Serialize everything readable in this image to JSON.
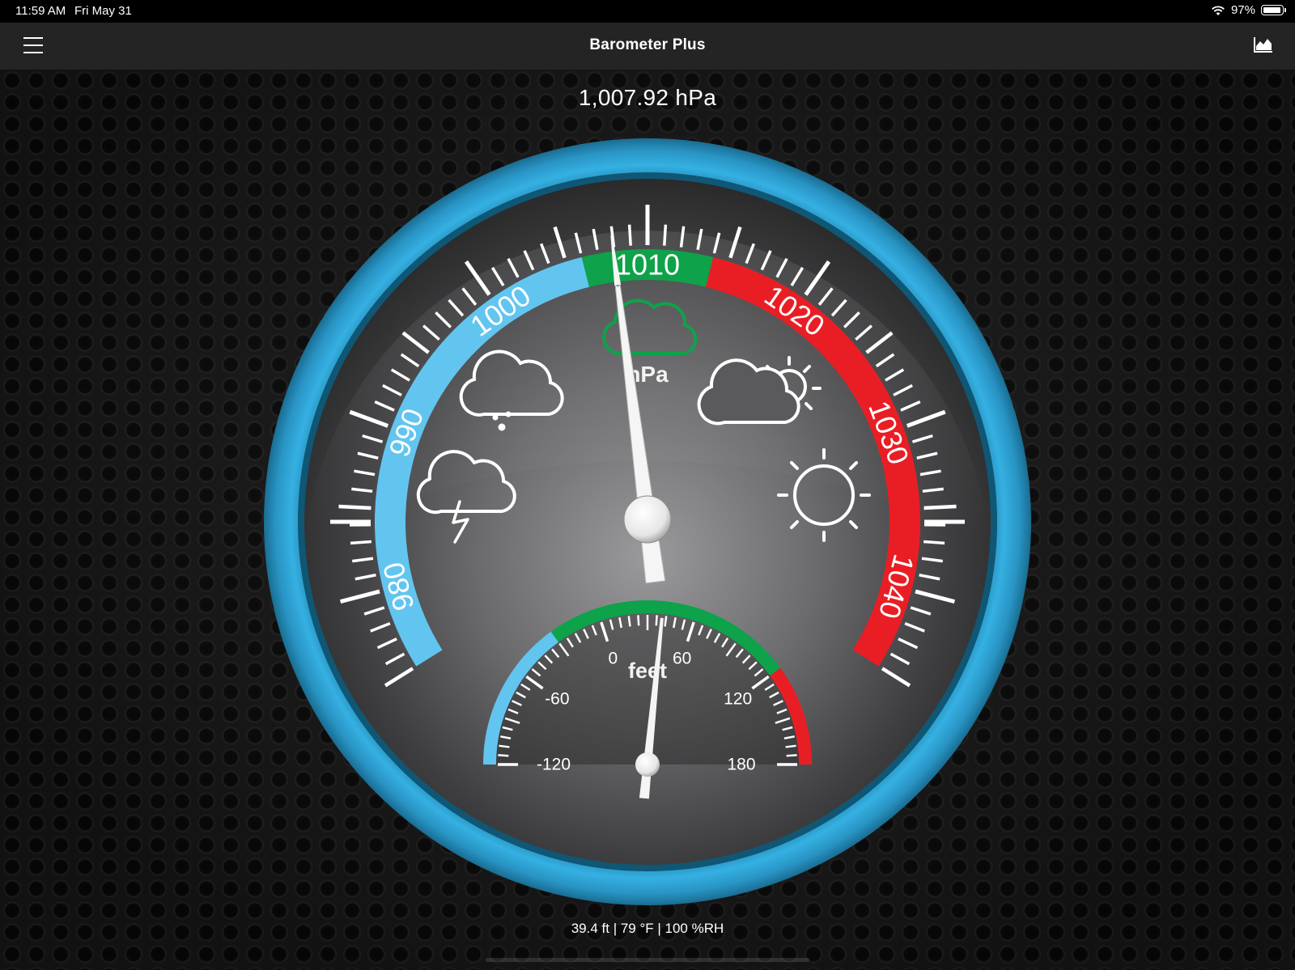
{
  "status_bar": {
    "time": "11:59 AM",
    "date": "Fri May 31",
    "battery": "97%",
    "battery_level": 0.97,
    "wifi_icon": "wifi-icon",
    "battery_icon": "battery-icon"
  },
  "nav": {
    "title": "Barometer Plus",
    "menu_icon": "hamburger-menu-icon",
    "chart_icon": "area-chart-icon"
  },
  "reading": {
    "pressure": "1,007.92 hPa"
  },
  "barometer": {
    "unit": "hPa",
    "min": 975,
    "max": 1045,
    "value": 1007.92,
    "labels": [
      "980",
      "990",
      "1000",
      "1010",
      "1020",
      "1030",
      "1040"
    ],
    "label_values": [
      980,
      990,
      1000,
      1010,
      1020,
      1030,
      1040
    ],
    "zones": [
      {
        "from": 975,
        "to": 1006,
        "color": "#62c5ef"
      },
      {
        "from": 1006,
        "to": 1014,
        "color": "#0ea24a"
      },
      {
        "from": 1014,
        "to": 1045,
        "color": "#e91e25"
      }
    ],
    "weather_icons": [
      "thunderstorm-icon",
      "rain-cloud-icon",
      "cloud-icon",
      "partly-sunny-icon",
      "sun-icon"
    ],
    "bezel_color": "#2b9fd0"
  },
  "altimeter": {
    "unit": "feet",
    "min": -120,
    "max": 180,
    "value": 39.4,
    "labels": [
      "-120",
      "-60",
      "0",
      "60",
      "120",
      "180"
    ],
    "label_values": [
      -120,
      -60,
      0,
      60,
      120,
      180
    ],
    "zones": [
      {
        "from": -120,
        "to": -30,
        "color": "#62c5ef"
      },
      {
        "from": -30,
        "to": 120,
        "color": "#0ea24a"
      },
      {
        "from": 120,
        "to": 180,
        "color": "#e91e25"
      }
    ]
  },
  "footer": {
    "info": "39.4 ft | 79 °F | 100 %RH"
  }
}
